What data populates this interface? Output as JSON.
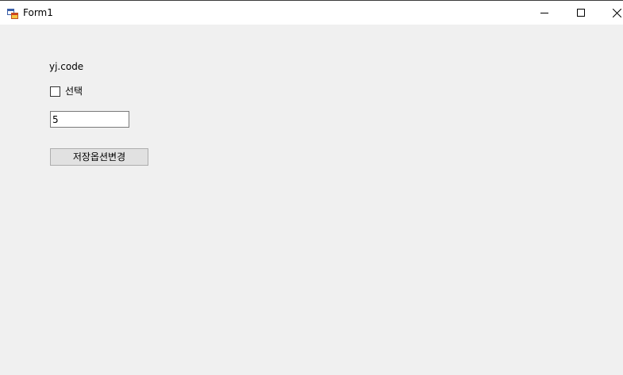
{
  "window": {
    "title": "Form1",
    "icon": "winforms-app-icon",
    "controls": {
      "minimize": "minimize-icon",
      "maximize": "maximize-icon",
      "close": "close-icon"
    }
  },
  "form": {
    "label_text": "yj.code",
    "checkbox": {
      "label": "선택",
      "checked": false
    },
    "textbox_value": "5",
    "button_label": "저장옵션변경"
  },
  "colors": {
    "background": "#f0f0f0",
    "titlebar": "#ffffff",
    "button_face": "#e1e1e1",
    "button_border": "#adadad"
  }
}
